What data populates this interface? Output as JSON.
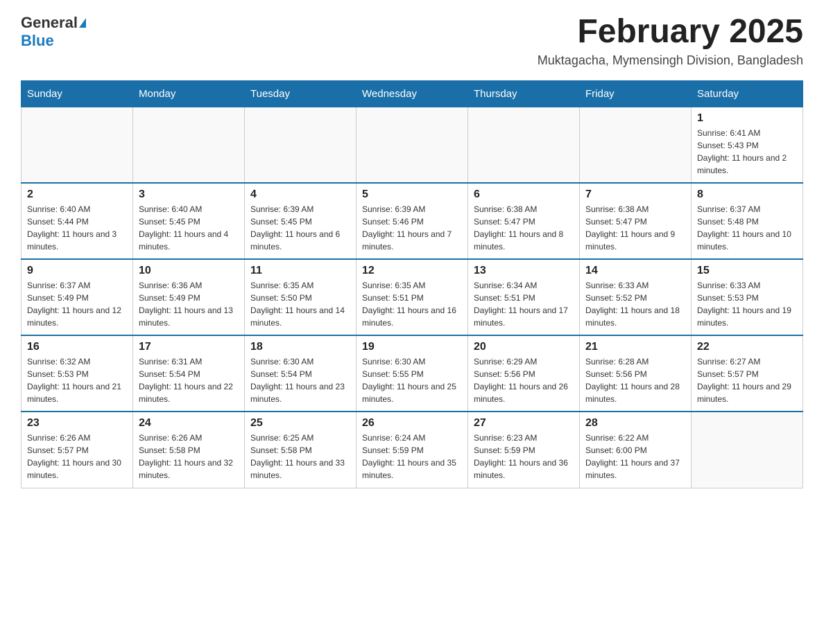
{
  "header": {
    "logo_general": "General",
    "logo_blue": "Blue",
    "month_title": "February 2025",
    "location": "Muktagacha, Mymensingh Division, Bangladesh"
  },
  "days_of_week": [
    "Sunday",
    "Monday",
    "Tuesday",
    "Wednesday",
    "Thursday",
    "Friday",
    "Saturday"
  ],
  "weeks": [
    [
      {
        "day": "",
        "info": ""
      },
      {
        "day": "",
        "info": ""
      },
      {
        "day": "",
        "info": ""
      },
      {
        "day": "",
        "info": ""
      },
      {
        "day": "",
        "info": ""
      },
      {
        "day": "",
        "info": ""
      },
      {
        "day": "1",
        "info": "Sunrise: 6:41 AM\nSunset: 5:43 PM\nDaylight: 11 hours and 2 minutes."
      }
    ],
    [
      {
        "day": "2",
        "info": "Sunrise: 6:40 AM\nSunset: 5:44 PM\nDaylight: 11 hours and 3 minutes."
      },
      {
        "day": "3",
        "info": "Sunrise: 6:40 AM\nSunset: 5:45 PM\nDaylight: 11 hours and 4 minutes."
      },
      {
        "day": "4",
        "info": "Sunrise: 6:39 AM\nSunset: 5:45 PM\nDaylight: 11 hours and 6 minutes."
      },
      {
        "day": "5",
        "info": "Sunrise: 6:39 AM\nSunset: 5:46 PM\nDaylight: 11 hours and 7 minutes."
      },
      {
        "day": "6",
        "info": "Sunrise: 6:38 AM\nSunset: 5:47 PM\nDaylight: 11 hours and 8 minutes."
      },
      {
        "day": "7",
        "info": "Sunrise: 6:38 AM\nSunset: 5:47 PM\nDaylight: 11 hours and 9 minutes."
      },
      {
        "day": "8",
        "info": "Sunrise: 6:37 AM\nSunset: 5:48 PM\nDaylight: 11 hours and 10 minutes."
      }
    ],
    [
      {
        "day": "9",
        "info": "Sunrise: 6:37 AM\nSunset: 5:49 PM\nDaylight: 11 hours and 12 minutes."
      },
      {
        "day": "10",
        "info": "Sunrise: 6:36 AM\nSunset: 5:49 PM\nDaylight: 11 hours and 13 minutes."
      },
      {
        "day": "11",
        "info": "Sunrise: 6:35 AM\nSunset: 5:50 PM\nDaylight: 11 hours and 14 minutes."
      },
      {
        "day": "12",
        "info": "Sunrise: 6:35 AM\nSunset: 5:51 PM\nDaylight: 11 hours and 16 minutes."
      },
      {
        "day": "13",
        "info": "Sunrise: 6:34 AM\nSunset: 5:51 PM\nDaylight: 11 hours and 17 minutes."
      },
      {
        "day": "14",
        "info": "Sunrise: 6:33 AM\nSunset: 5:52 PM\nDaylight: 11 hours and 18 minutes."
      },
      {
        "day": "15",
        "info": "Sunrise: 6:33 AM\nSunset: 5:53 PM\nDaylight: 11 hours and 19 minutes."
      }
    ],
    [
      {
        "day": "16",
        "info": "Sunrise: 6:32 AM\nSunset: 5:53 PM\nDaylight: 11 hours and 21 minutes."
      },
      {
        "day": "17",
        "info": "Sunrise: 6:31 AM\nSunset: 5:54 PM\nDaylight: 11 hours and 22 minutes."
      },
      {
        "day": "18",
        "info": "Sunrise: 6:30 AM\nSunset: 5:54 PM\nDaylight: 11 hours and 23 minutes."
      },
      {
        "day": "19",
        "info": "Sunrise: 6:30 AM\nSunset: 5:55 PM\nDaylight: 11 hours and 25 minutes."
      },
      {
        "day": "20",
        "info": "Sunrise: 6:29 AM\nSunset: 5:56 PM\nDaylight: 11 hours and 26 minutes."
      },
      {
        "day": "21",
        "info": "Sunrise: 6:28 AM\nSunset: 5:56 PM\nDaylight: 11 hours and 28 minutes."
      },
      {
        "day": "22",
        "info": "Sunrise: 6:27 AM\nSunset: 5:57 PM\nDaylight: 11 hours and 29 minutes."
      }
    ],
    [
      {
        "day": "23",
        "info": "Sunrise: 6:26 AM\nSunset: 5:57 PM\nDaylight: 11 hours and 30 minutes."
      },
      {
        "day": "24",
        "info": "Sunrise: 6:26 AM\nSunset: 5:58 PM\nDaylight: 11 hours and 32 minutes."
      },
      {
        "day": "25",
        "info": "Sunrise: 6:25 AM\nSunset: 5:58 PM\nDaylight: 11 hours and 33 minutes."
      },
      {
        "day": "26",
        "info": "Sunrise: 6:24 AM\nSunset: 5:59 PM\nDaylight: 11 hours and 35 minutes."
      },
      {
        "day": "27",
        "info": "Sunrise: 6:23 AM\nSunset: 5:59 PM\nDaylight: 11 hours and 36 minutes."
      },
      {
        "day": "28",
        "info": "Sunrise: 6:22 AM\nSunset: 6:00 PM\nDaylight: 11 hours and 37 minutes."
      },
      {
        "day": "",
        "info": ""
      }
    ]
  ]
}
